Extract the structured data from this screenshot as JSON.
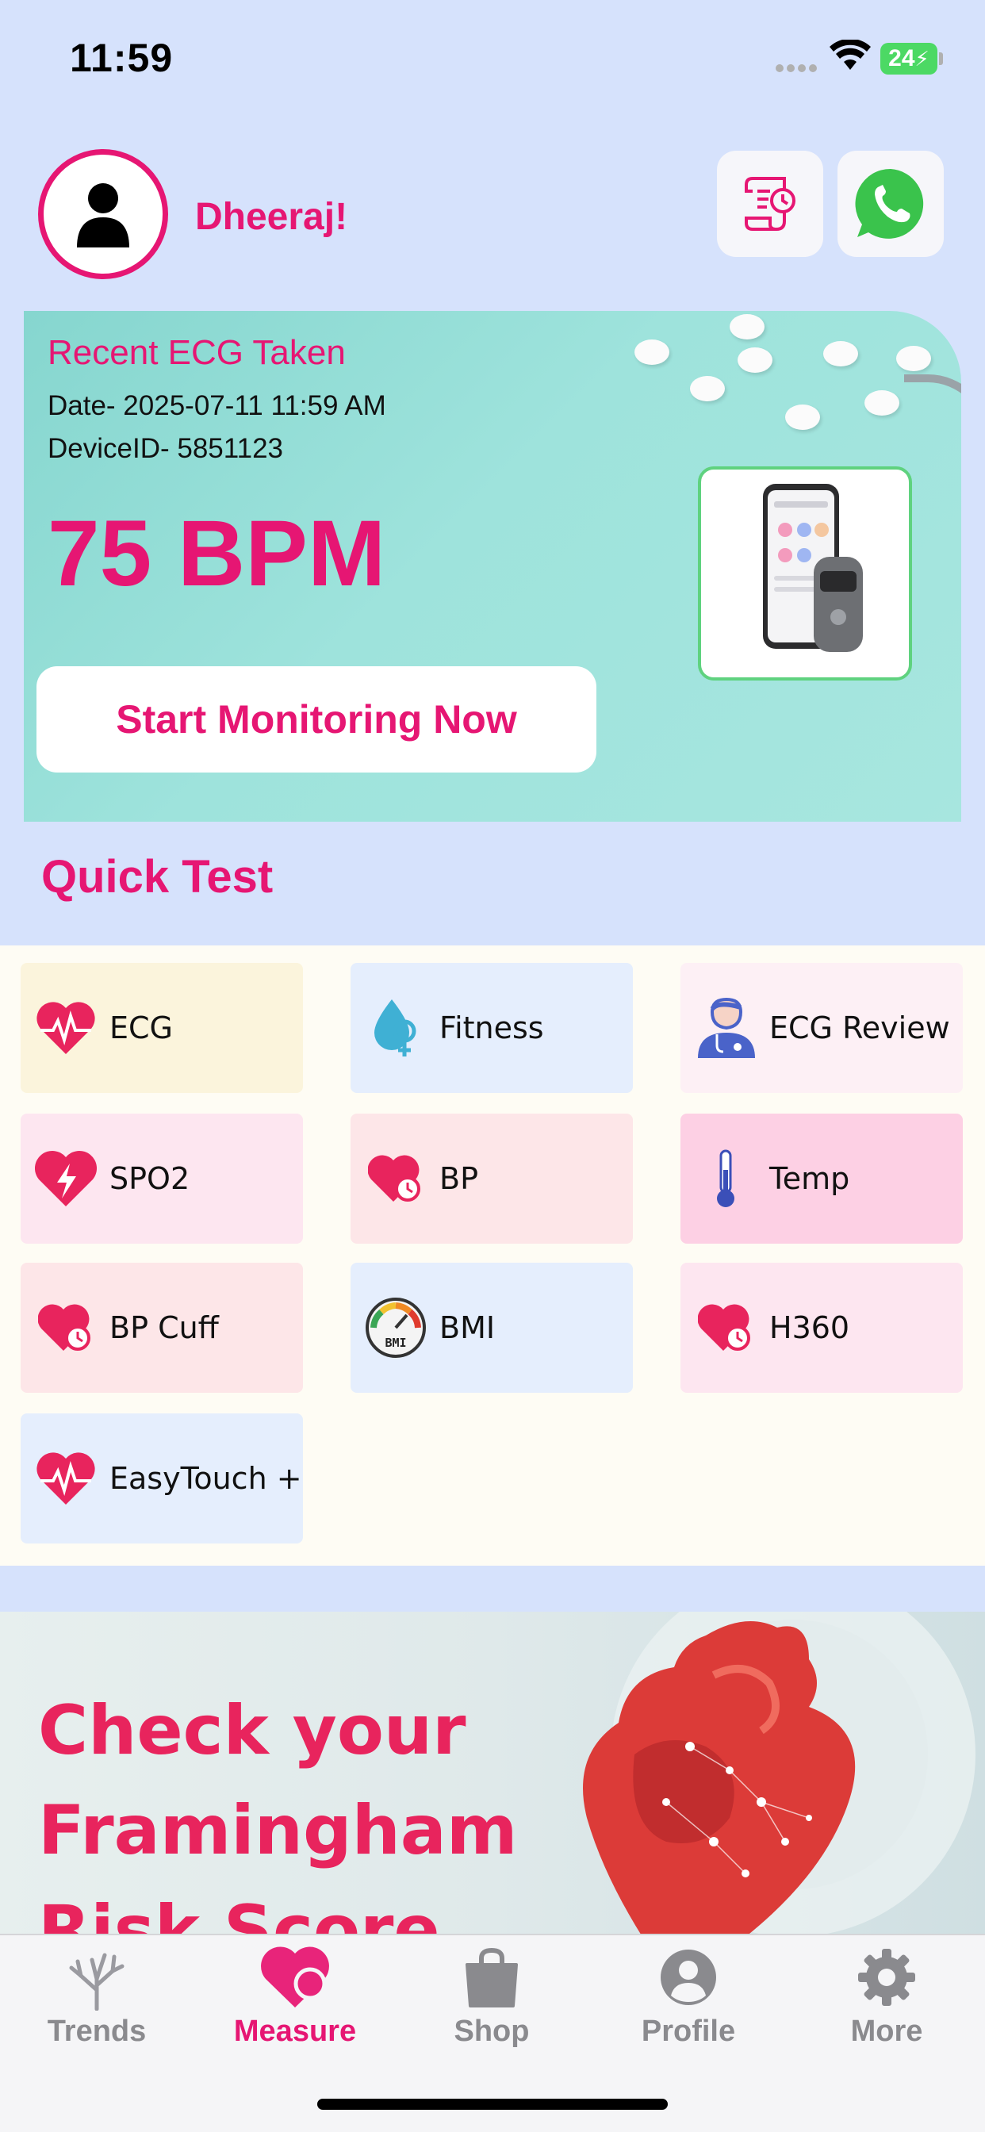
{
  "status_bar": {
    "time": "11:59",
    "battery": "24"
  },
  "header": {
    "username": "Dheeraj!"
  },
  "banner": {
    "title": "Recent ECG Taken",
    "date": "Date- 2025-07-11 11:59 AM",
    "device": "DeviceID- 5851123",
    "bpm": "75 BPM",
    "cta": "Start Monitoring Now"
  },
  "quick_test": {
    "title": "Quick Test",
    "tiles": [
      {
        "label": "ECG",
        "icon": "heart-pulse-icon",
        "bg": "#fbf4dc"
      },
      {
        "label": "Fitness",
        "icon": "water-drop-female-icon",
        "bg": "#e5eefd"
      },
      {
        "label": "ECG Review",
        "icon": "doctor-icon",
        "bg": "#fdf0f5"
      },
      {
        "label": "SPO2",
        "icon": "heart-bolt-icon",
        "bg": "#fde6f0"
      },
      {
        "label": "BP",
        "icon": "heart-gauge-icon",
        "bg": "#fde6e8"
      },
      {
        "label": "Temp",
        "icon": "thermometer-icon",
        "bg": "#fdd0e4"
      },
      {
        "label": "BP Cuff",
        "icon": "heart-gauge-icon",
        "bg": "#fde6e8"
      },
      {
        "label": "BMI",
        "icon": "bmi-gauge-icon",
        "bg": "#e5eefd"
      },
      {
        "label": "H360",
        "icon": "heart-gauge-icon",
        "bg": "#fde6f0"
      },
      {
        "label": "EasyTouch +",
        "icon": "heart-pulse-icon",
        "bg": "#e5eefd"
      }
    ]
  },
  "promo": {
    "lines": [
      "Check your",
      "Framingham",
      "Risk Score"
    ]
  },
  "tabbar": {
    "tabs": [
      {
        "label": "Trends",
        "icon": "tree-icon"
      },
      {
        "label": "Measure",
        "icon": "heart-icon"
      },
      {
        "label": "Shop",
        "icon": "shopping-bag-icon"
      },
      {
        "label": "Profile",
        "icon": "person-icon"
      },
      {
        "label": "More",
        "icon": "gear-icon"
      }
    ],
    "active": "Measure"
  },
  "colors": {
    "accent": "#e61673",
    "background": "#d6e2fc",
    "promo_text": "#e8245d"
  }
}
